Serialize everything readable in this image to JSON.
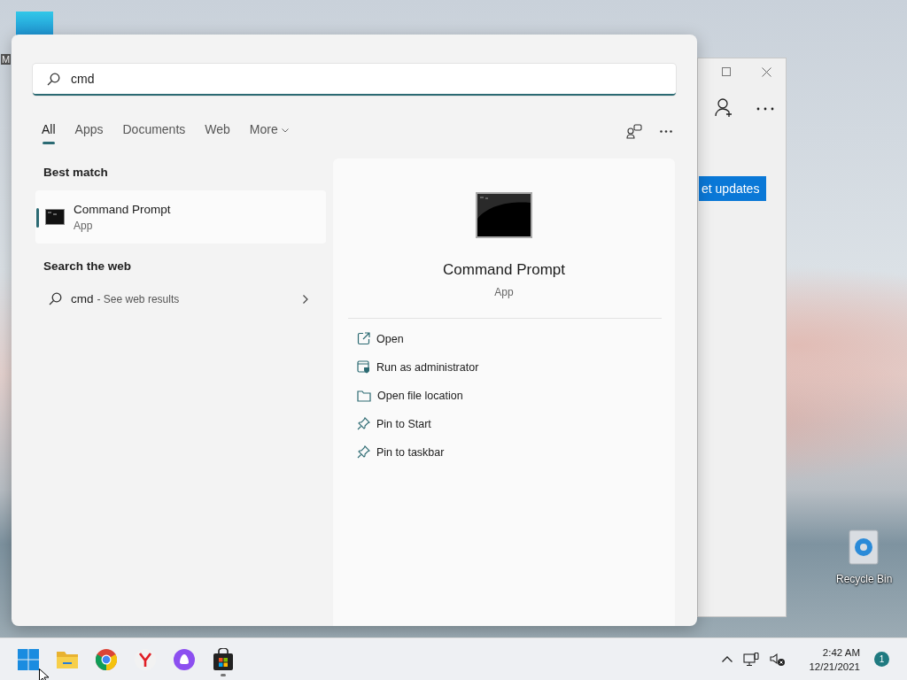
{
  "desktop": {
    "icons": [
      {
        "kind": "app",
        "label": "M"
      },
      {
        "kind": "recycle",
        "label": "Recycle Bin"
      }
    ]
  },
  "background_window": {
    "button": "et updates"
  },
  "search_panel": {
    "query": "cmd",
    "tabs": [
      {
        "label": "All",
        "selected": true,
        "chevron": false
      },
      {
        "label": "Apps",
        "selected": false,
        "chevron": false
      },
      {
        "label": "Documents",
        "selected": false,
        "chevron": false
      },
      {
        "label": "Web",
        "selected": false,
        "chevron": false
      },
      {
        "label": "More",
        "selected": false,
        "chevron": true
      }
    ],
    "best_match": {
      "heading": "Best match",
      "items": [
        {
          "title": "Command Prompt",
          "subtitle": "App",
          "selected": true
        }
      ]
    },
    "web": {
      "heading": "Search the web",
      "query": "cmd",
      "hint": "- See web results"
    },
    "details": {
      "title": "Command Prompt",
      "subtitle": "App",
      "actions": [
        {
          "kind": "open",
          "label": "Open"
        },
        {
          "kind": "admin",
          "label": "Run as administrator"
        },
        {
          "kind": "folder",
          "label": "Open file location"
        },
        {
          "kind": "pin",
          "label": "Pin to Start"
        },
        {
          "kind": "pin",
          "label": "Pin to taskbar"
        }
      ]
    }
  },
  "taskbar": {
    "apps": [
      {
        "kind": "start",
        "running": false
      },
      {
        "kind": "explorer",
        "running": false
      },
      {
        "kind": "chrome",
        "running": false
      },
      {
        "kind": "yandex",
        "running": false
      },
      {
        "kind": "alice",
        "running": false
      },
      {
        "kind": "store",
        "running": true
      }
    ],
    "time": "2:42 AM",
    "date": "12/21/2021",
    "badge": "1"
  }
}
